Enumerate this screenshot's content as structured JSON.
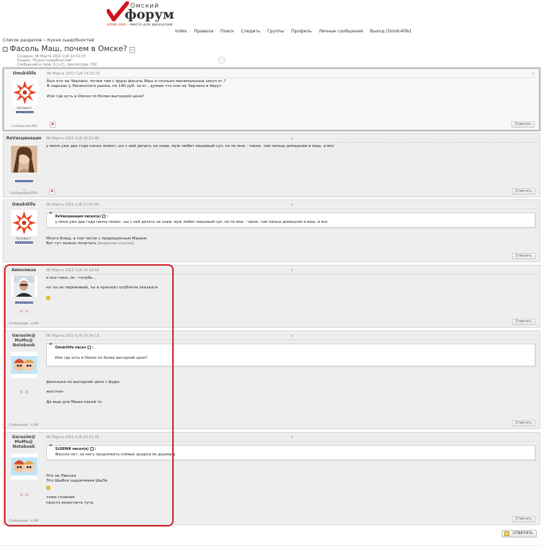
{
  "logo": {
    "small": "Омский",
    "big": "форум",
    "site": "omsk.com",
    "tagline": "- место для дискуссий"
  },
  "nav": [
    "Index",
    "Правила",
    "Поиск",
    "Следить",
    "Группы",
    "Профиль",
    "Личные сообщения",
    "Выход [Omsk4life]"
  ],
  "breadcrumbs": [
    "Список разделов",
    "Кухня сьедобностей"
  ],
  "topic": {
    "title": "Фасоль Маш, почем в Омске?",
    "created": "Создана: 06 Марта 2021 Суб 14:32:23",
    "section": "Раздел: \"Кухня сьедобностей\"",
    "stats": "Сообщений в теме: 6 [+2], просмотров: 292"
  },
  "buttons": {
    "reply": "Ответить",
    "reply_bottom": "ОТВЕТИТЬ"
  },
  "posts": [
    {
      "author": "Omsk4life",
      "rank": "Активист",
      "msgcount": "Сообщений:202",
      "date": "06 Марта 2021 Суб 14:32:23",
      "lines": [
        "Был кто на Черлаке, почем там с фуры фасоль Маш и сколько минимальный закуп кг.?",
        "В ларьках у Ленинского рынка, по 160 руб. за кг., думаю что они на Черлаке и берут.",
        "",
        "Или где есть в Омске по более выгодной цене?"
      ]
    },
    {
      "author": "ReVакцинация",
      "msgcount": "Сообщений:4924",
      "date": "06 Марта 2021 Суб 16:22:46",
      "lines": [
        "у меня уже два года пачка лежит, шо с ней делать не знаю. муж любит машевый суп, но по мне - такое. там лапша домашняя и маш. и все"
      ]
    },
    {
      "author": "Omsk4life",
      "rank": "Активист",
      "date": "06 Марта 2021 Суб 17:07:00",
      "quote_author": "ReVакцинация писал(а)",
      "quote_text": "у меня уже два года пачка лежит, шо с ней делать не знаю. муж любит машевый суп, но по мне - такое. там лапша домашняя и маш. и все",
      "lines": [
        "Много блюд, в том числе с пророщенным Машем",
        "Вот тут можно почитать"
      ],
      "link": "[внешняя ссылка]"
    },
    {
      "author": "Амонлюза",
      "msgcount": "Сообщений: >10К",
      "online": "0 - 0",
      "date": "06 Марта 2021 Суб 19:19:54",
      "lines": [
        "и все-таки, он - голубь...",
        "",
        "но ты не переживай, ты в нужной голубятне оказался"
      ]
    },
    {
      "author": "Gerasim@ MuMu@ Notebook",
      "msgcount": "Сообщений: >10К",
      "online": "0 - 0",
      "date": "06 Марта 2021 Суб 19:34:13",
      "quote_author": "Omsk4life писал",
      "quote_text": "Или где есть в Омске по более выгодной цене?",
      "lines": [
        "фасолька по выгодной цене с фуры",
        "",
        "жесткач",
        "",
        "Да еще для Маши какой то"
      ]
    },
    {
      "author": "Gerasim@ MuMu@ Notebook",
      "msgcount": "Сообщений: >10К",
      "online": "0 - 0",
      "date": "06 Марта 2021 Суб 20:23:39",
      "quote_author": "SLDENIK писал(а)",
      "quote_text": "Фасоли нет, но могу предложить клёвые шнурки по дешману.",
      "lines_a": [
        "Это не Люська",
        "Это Шыбка задумчивая ШыЗа"
      ],
      "lines_b": [
        "тоже гнойная",
        "просто инкогнито тута"
      ]
    }
  ]
}
